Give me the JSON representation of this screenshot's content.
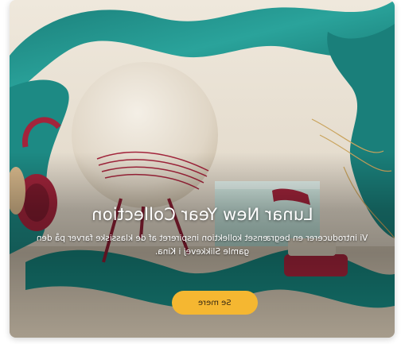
{
  "promo": {
    "title": "Lunar New Year Collection",
    "description": "Vi introducerer en begrænset kollektion inspireret af de klassiske farver på den gamle Slikkevej i Kina.",
    "cta_label": "Se mere"
  },
  "colors": {
    "accent_button": "#f5b731",
    "fabric_teal": "#1f8b86",
    "product_red": "#a3243b",
    "background_cream": "#e9e2d6"
  }
}
